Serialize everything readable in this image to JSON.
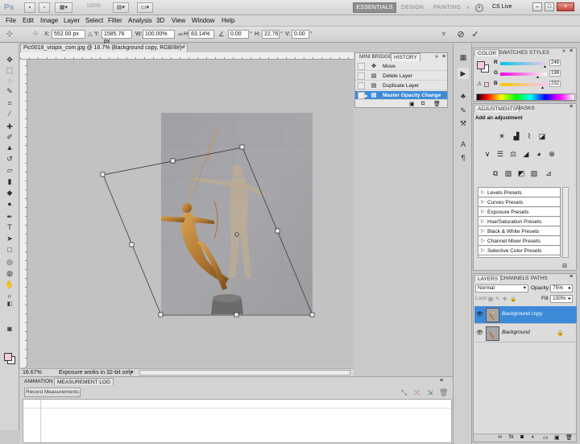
{
  "app": {
    "logo": "Ps"
  },
  "titlebar": {
    "zoom_value": "100%",
    "workspaces": [
      "ESSENTIALS",
      "DESIGN",
      "PAINTING",
      "»"
    ],
    "cs_live": "CS Live"
  },
  "menu": [
    "File",
    "Edit",
    "Image",
    "Layer",
    "Select",
    "Filter",
    "Analysis",
    "3D",
    "View",
    "Window",
    "Help"
  ],
  "options": {
    "x_label": "X:",
    "x_value": "552.00 px",
    "y_label": "Y:",
    "y_value": "1585.76 px",
    "w_label": "W:",
    "w_value": "100.00%",
    "h_label": "H:",
    "h_value": "83.14%",
    "angle_value": "0.00",
    "hskew_label": "H:",
    "hskew_value": "22.76",
    "vskew_label": "V:",
    "vskew_value": "0.00"
  },
  "document": {
    "tab_title": "Pic0018_visipix_com.jpg @ 16.7% (Background copy, RGB/8#) *",
    "zoom": "16.67%",
    "status": "Exposure works in 32-bit only"
  },
  "history": {
    "tabs": [
      "MINI BRIDGE",
      "HISTORY"
    ],
    "items": [
      {
        "label": "Move",
        "selected": false
      },
      {
        "label": "Delete Layer",
        "selected": false
      },
      {
        "label": "Duplicate Layer",
        "selected": false
      },
      {
        "label": "Master Opacity Change",
        "selected": true
      }
    ]
  },
  "color_panel": {
    "tabs": [
      "COLOR",
      "SWATCHES",
      "STYLES"
    ],
    "r_label": "R",
    "r_value": "248",
    "g_label": "G",
    "g_value": "198",
    "b_label": "B",
    "b_value": "232",
    "foreground_color": "#f8c6e8"
  },
  "adjustments": {
    "tabs": [
      "ADJUSTMENTS",
      "MASKS"
    ],
    "heading": "Add an adjustment",
    "presets": [
      "Levels Presets",
      "Curves Presets",
      "Exposure Presets",
      "Hue/Saturation Presets",
      "Black & White Presets",
      "Channel Mixer Presets",
      "Selective Color Presets"
    ]
  },
  "layers": {
    "tabs": [
      "LAYERS",
      "CHANNELS",
      "PATHS"
    ],
    "blend_mode": "Normal",
    "opacity_label": "Opacity:",
    "opacity_value": "75%",
    "lock_label": "Lock:",
    "fill_label": "Fill:",
    "fill_value": "100%",
    "items": [
      {
        "name": "Background copy",
        "selected": true
      },
      {
        "name": "Background",
        "selected": false
      }
    ]
  },
  "bottom_panel": {
    "tabs": [
      "ANIMATION",
      "MEASUREMENT LOG"
    ],
    "record_button": "Record Measurements"
  },
  "colors": {
    "accent": "#3d8ad8",
    "selection_text": "#ffffff"
  }
}
